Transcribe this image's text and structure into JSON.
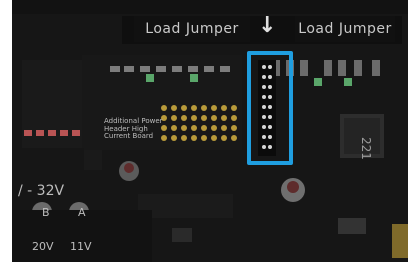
{
  "board": {
    "load_label_left": "Load Jumper",
    "load_label_right": "Load Jumper",
    "voltage_text": "/ - 32V",
    "label_b": "B",
    "label_a": "A",
    "label_20v": "20V",
    "label_11v": "11V",
    "chip_code": "221",
    "small_label": "Additional Power\nHeader High Current Board"
  },
  "arrow": "↓",
  "highlight_color": "#1f9ee0"
}
